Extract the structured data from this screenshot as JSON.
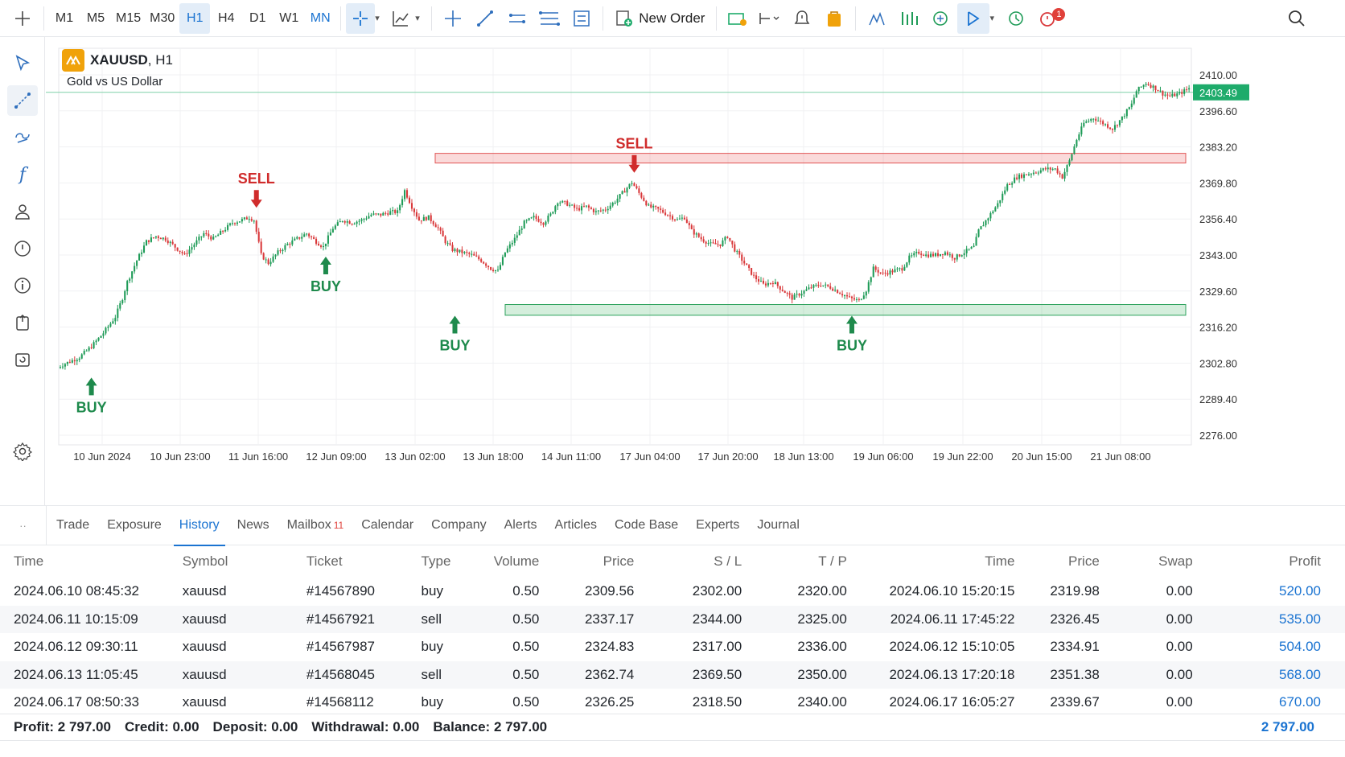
{
  "toolbar": {
    "menu_icon": "crosshair-plus-icon",
    "timeframes": [
      "M1",
      "M5",
      "M15",
      "M30",
      "H1",
      "H4",
      "D1",
      "W1",
      "MN"
    ],
    "active_timeframe": "H1",
    "new_order_label": "New Order",
    "notification_count": "1"
  },
  "symbol": {
    "name": "XAUUSD",
    "timeframe": ", H1",
    "description": "Gold vs US Dollar"
  },
  "chart_data": {
    "type": "candlestick",
    "symbol": "XAUUSD",
    "current_price": "2403.49",
    "y_ticks": [
      "2410.00",
      "2396.60",
      "2383.20",
      "2369.80",
      "2356.40",
      "2343.00",
      "2329.60",
      "2316.20",
      "2302.80",
      "2289.40",
      "2276.00"
    ],
    "y_tick_values": [
      2410.0,
      2396.6,
      2383.2,
      2369.8,
      2356.4,
      2343.0,
      2329.6,
      2316.2,
      2302.8,
      2289.4,
      2276.0
    ],
    "x_ticks": [
      "10 Jun 2024",
      "10 Jun 23:00",
      "11 Jun 16:00",
      "12 Jun 09:00",
      "13 Jun 02:00",
      "13 Jun 18:00",
      "14 Jun 11:00",
      "17 Jun 04:00",
      "17 Jun 20:00",
      "18 Jun 13:00",
      "19 Jun 06:00",
      "19 Jun 22:00",
      "20 Jun 15:00",
      "21 Jun 08:00"
    ],
    "price_path": [
      [
        0,
        2301
      ],
      [
        5,
        2303
      ],
      [
        10,
        2305
      ],
      [
        15,
        2309
      ],
      [
        20,
        2314
      ],
      [
        25,
        2320
      ],
      [
        28,
        2327
      ],
      [
        30,
        2333
      ],
      [
        34,
        2341
      ],
      [
        38,
        2348
      ],
      [
        42,
        2350
      ],
      [
        46,
        2349
      ],
      [
        50,
        2346
      ],
      [
        54,
        2343
      ],
      [
        58,
        2347
      ],
      [
        62,
        2351
      ],
      [
        66,
        2349
      ],
      [
        70,
        2352
      ],
      [
        74,
        2355
      ],
      [
        78,
        2356
      ],
      [
        81,
        2357
      ],
      [
        83,
        2356
      ],
      [
        86,
        2343
      ],
      [
        89,
        2340
      ],
      [
        93,
        2344
      ],
      [
        97,
        2347
      ],
      [
        101,
        2349
      ],
      [
        105,
        2351
      ],
      [
        109,
        2348
      ],
      [
        112,
        2346
      ],
      [
        116,
        2353
      ],
      [
        120,
        2356
      ],
      [
        124,
        2355
      ],
      [
        128,
        2356
      ],
      [
        132,
        2358
      ],
      [
        136,
        2358
      ],
      [
        140,
        2359
      ],
      [
        143,
        2359
      ],
      [
        146,
        2367
      ],
      [
        149,
        2361
      ],
      [
        152,
        2356
      ],
      [
        156,
        2357
      ],
      [
        160,
        2353
      ],
      [
        163,
        2348
      ],
      [
        166,
        2345
      ],
      [
        170,
        2344
      ],
      [
        174,
        2343
      ],
      [
        178,
        2341
      ],
      [
        182,
        2338
      ],
      [
        185,
        2337
      ],
      [
        188,
        2344
      ],
      [
        192,
        2349
      ],
      [
        196,
        2355
      ],
      [
        200,
        2357
      ],
      [
        204,
        2355
      ],
      [
        207,
        2358
      ],
      [
        210,
        2363
      ],
      [
        214,
        2362
      ],
      [
        218,
        2360
      ],
      [
        222,
        2361
      ],
      [
        226,
        2359
      ],
      [
        230,
        2360
      ],
      [
        234,
        2363
      ],
      [
        238,
        2367
      ],
      [
        241,
        2370
      ],
      [
        244,
        2366
      ],
      [
        248,
        2361
      ],
      [
        252,
        2360
      ],
      [
        256,
        2358
      ],
      [
        260,
        2356
      ],
      [
        263,
        2357
      ],
      [
        266,
        2352
      ],
      [
        270,
        2349
      ],
      [
        274,
        2347
      ],
      [
        278,
        2347
      ],
      [
        281,
        2350
      ],
      [
        284,
        2345
      ],
      [
        288,
        2340
      ],
      [
        292,
        2335
      ],
      [
        296,
        2332
      ],
      [
        300,
        2333
      ],
      [
        304,
        2330
      ],
      [
        308,
        2327
      ],
      [
        312,
        2329
      ],
      [
        316,
        2331
      ],
      [
        320,
        2332
      ],
      [
        324,
        2331
      ],
      [
        328,
        2329
      ],
      [
        332,
        2327
      ],
      [
        336,
        2326
      ],
      [
        339,
        2330
      ],
      [
        342,
        2338
      ],
      [
        346,
        2336
      ],
      [
        350,
        2337
      ],
      [
        354,
        2338
      ],
      [
        357,
        2342
      ],
      [
        361,
        2344
      ],
      [
        364,
        2343
      ],
      [
        368,
        2343
      ],
      [
        372,
        2344
      ],
      [
        376,
        2342
      ],
      [
        380,
        2344
      ],
      [
        384,
        2346
      ],
      [
        386,
        2352
      ],
      [
        390,
        2357
      ],
      [
        394,
        2362
      ],
      [
        398,
        2369
      ],
      [
        402,
        2372
      ],
      [
        406,
        2373
      ],
      [
        410,
        2374
      ],
      [
        414,
        2375
      ],
      [
        418,
        2375
      ],
      [
        421,
        2372
      ],
      [
        424,
        2378
      ],
      [
        427,
        2386
      ],
      [
        430,
        2392
      ],
      [
        434,
        2394
      ],
      [
        438,
        2392
      ],
      [
        442,
        2390
      ],
      [
        446,
        2394
      ],
      [
        450,
        2399
      ],
      [
        452,
        2404
      ],
      [
        456,
        2407
      ],
      [
        460,
        2405
      ],
      [
        463,
        2403
      ],
      [
        466,
        2402
      ],
      [
        470,
        2403
      ],
      [
        474,
        2405
      ],
      [
        478,
        2403.49
      ]
    ],
    "resistance_zone": [
      2380.8,
      2377.2
    ],
    "support_zone": [
      2324.6,
      2320.6
    ],
    "annotations": [
      {
        "label": "BUY",
        "type": "buy",
        "bar": 14,
        "price": 2301
      },
      {
        "label": "SELL",
        "type": "sell",
        "bar": 83,
        "price": 2357
      },
      {
        "label": "BUY",
        "type": "buy",
        "bar": 112,
        "price": 2346
      },
      {
        "label": "SELL",
        "type": "sell",
        "bar": 241,
        "price": 2370
      },
      {
        "label": "BUY",
        "type": "buy",
        "bar": 166,
        "price": 2324
      },
      {
        "label": "BUY",
        "type": "buy",
        "bar": 332,
        "price": 2324
      }
    ]
  },
  "tabs": [
    {
      "label": "Trade"
    },
    {
      "label": "Exposure"
    },
    {
      "label": "History"
    },
    {
      "label": "News"
    },
    {
      "label": "Mailbox",
      "count": "11"
    },
    {
      "label": "Calendar"
    },
    {
      "label": "Company"
    },
    {
      "label": "Alerts"
    },
    {
      "label": "Articles"
    },
    {
      "label": "Code Base"
    },
    {
      "label": "Experts"
    },
    {
      "label": "Journal"
    }
  ],
  "active_tab": "History",
  "history": {
    "columns": [
      "Time",
      "Symbol",
      "Ticket",
      "Type",
      "Volume",
      "Price",
      "S / L",
      "T / P",
      "Time",
      "Price",
      "Swap",
      "Profit"
    ],
    "rows": [
      [
        "2024.06.10 08:45:32",
        "xauusd",
        "#14567890",
        "buy",
        "0.50",
        "2309.56",
        "2302.00",
        "2320.00",
        "2024.06.10 15:20:15",
        "2319.98",
        "0.00",
        "520.00"
      ],
      [
        "2024.06.11 10:15:09",
        "xauusd",
        "#14567921",
        "sell",
        "0.50",
        "2337.17",
        "2344.00",
        "2325.00",
        "2024.06.11 17:45:22",
        "2326.45",
        "0.00",
        "535.00"
      ],
      [
        "2024.06.12 09:30:11",
        "xauusd",
        "#14567987",
        "buy",
        "0.50",
        "2324.83",
        "2317.00",
        "2336.00",
        "2024.06.12 15:10:05",
        "2334.91",
        "0.00",
        "504.00"
      ],
      [
        "2024.06.13 11:05:45",
        "xauusd",
        "#14568045",
        "sell",
        "0.50",
        "2362.74",
        "2369.50",
        "2350.00",
        "2024.06.13 17:20:18",
        "2351.38",
        "0.00",
        "568.00"
      ],
      [
        "2024.06.17 08:50:33",
        "xauusd",
        "#14568112",
        "buy",
        "0.50",
        "2326.25",
        "2318.50",
        "2340.00",
        "2024.06.17 16:05:27",
        "2339.67",
        "0.00",
        "670.00"
      ]
    ]
  },
  "summary": {
    "profit": "Profit:  2 797.00",
    "credit": "Credit:  0.00",
    "deposit": "Deposit:  0.00",
    "withdrawal": "Withdrawal:  0.00",
    "balance": "Balance:  2 797.00",
    "total": "2 797.00"
  },
  "colors": {
    "accent": "#1a73d1",
    "bull": "#1e9b57",
    "bear": "#d9383a",
    "price_tag": "#1eab6b",
    "brand_logo": "#f0a20a"
  }
}
